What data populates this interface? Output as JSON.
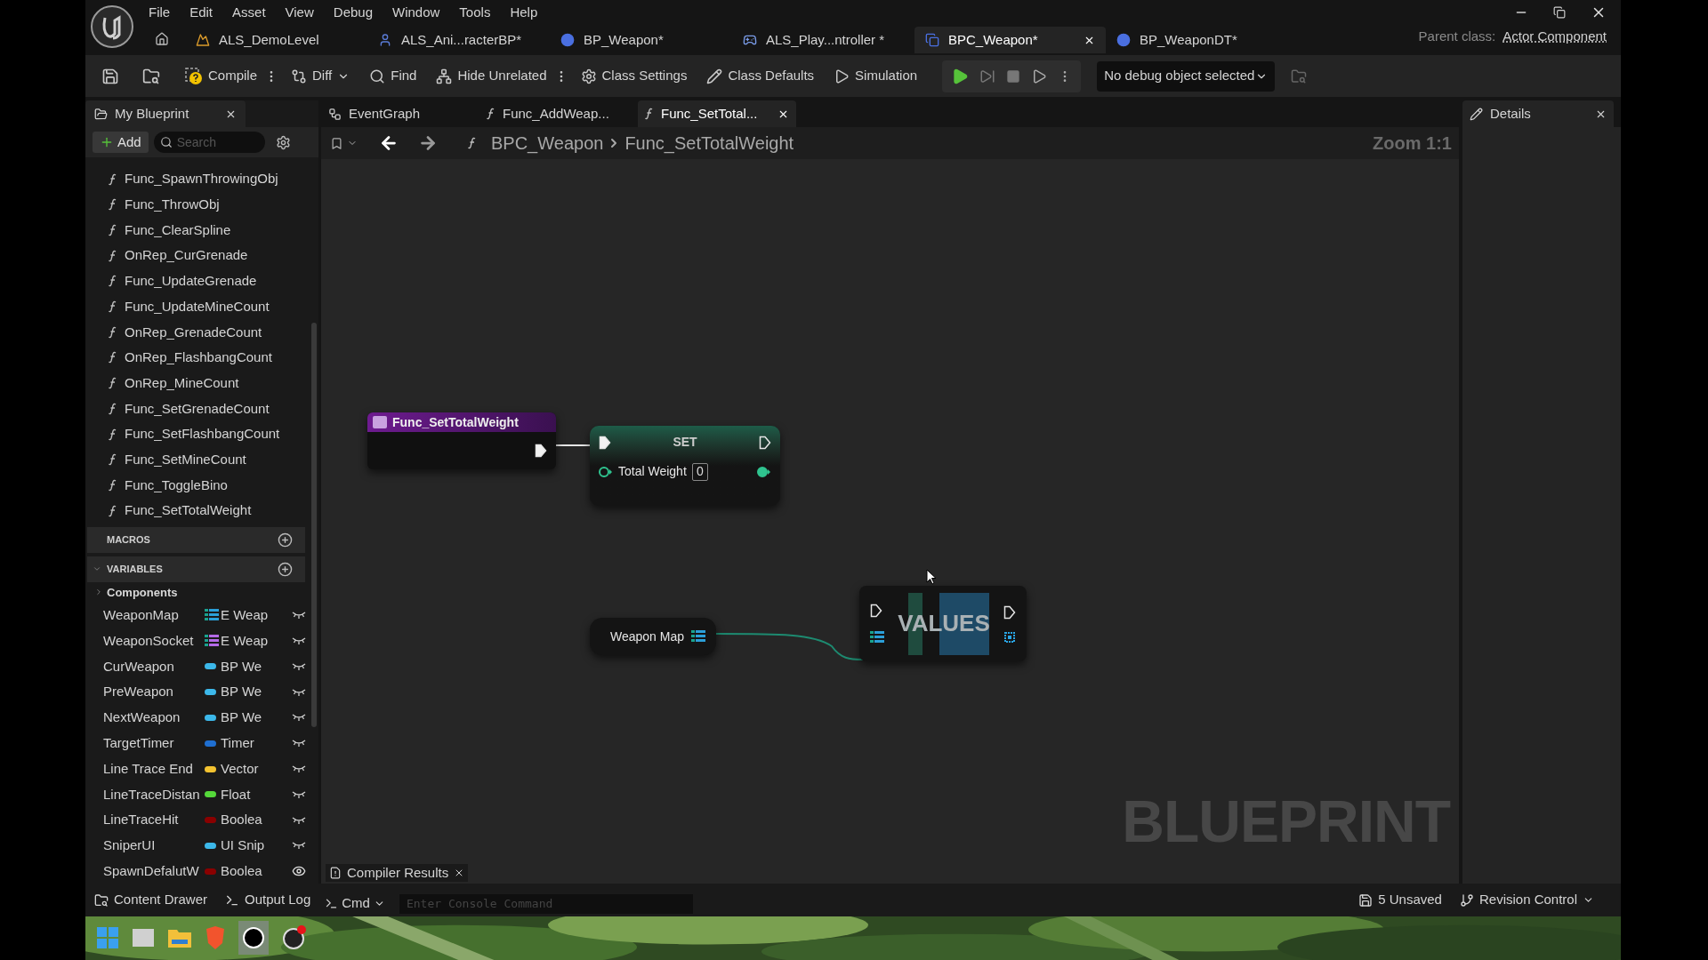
{
  "menu": [
    "File",
    "Edit",
    "Asset",
    "View",
    "Debug",
    "Window",
    "Tools",
    "Help"
  ],
  "document_tabs": [
    {
      "label": "ALS_DemoLevel",
      "kind": "level",
      "selected": false,
      "closable": false
    },
    {
      "label": "ALS_Ani...racterBP*",
      "kind": "character",
      "selected": false,
      "closable": false
    },
    {
      "label": "BP_Weapon*",
      "kind": "actor",
      "selected": false,
      "closable": false
    },
    {
      "label": "ALS_Play...ntroller *",
      "kind": "controller",
      "selected": false,
      "closable": false
    },
    {
      "label": "BPC_Weapon*",
      "kind": "component",
      "selected": true,
      "closable": true
    },
    {
      "label": "BP_WeaponDT*",
      "kind": "actor",
      "selected": false,
      "closable": false
    }
  ],
  "parent_class": {
    "label": "Parent class:",
    "value": "Actor Component"
  },
  "toolbar": [
    {
      "label": "Compile",
      "kind": "compile",
      "more": true
    },
    {
      "label": "Diff",
      "kind": "diff",
      "more": false
    },
    {
      "label": "Find",
      "kind": "find",
      "more": false
    },
    {
      "label": "Hide Unrelated",
      "kind": "hide",
      "more": true
    },
    {
      "label": "Class Settings",
      "kind": "settings",
      "more": false
    },
    {
      "label": "Class Defaults",
      "kind": "defaults",
      "more": false
    },
    {
      "label": "Simulation",
      "kind": "simulation",
      "more": false
    }
  ],
  "debug_dropdown": "No debug object selected",
  "my_blueprint": {
    "title": "My Blueprint",
    "add": "Add",
    "search_placeholder": "Search",
    "functions": [
      "Func_SpawnThrowingObj",
      "Func_ThrowObj",
      "Func_ClearSpline",
      "OnRep_CurGrenade",
      "Func_UpdateGrenade",
      "Func_UpdateMineCount",
      "OnRep_GrenadeCount",
      "OnRep_FlashbangCount",
      "OnRep_MineCount",
      "Func_SetGrenadeCount",
      "Func_SetFlashbangCount",
      "Func_SetMineCount",
      "Func_ToggleBino",
      "Func_SetTotalWeight"
    ],
    "sections": [
      {
        "label": "MACROS"
      },
      {
        "label": "VARIABLES",
        "expanded": true
      }
    ],
    "category": {
      "label": "Components",
      "expanded": false
    },
    "variables": [
      {
        "name": "WeaponMap",
        "type": "E Weap",
        "kind": "map",
        "color": "#2b9fd8",
        "visible": false
      },
      {
        "name": "WeaponSocket",
        "type": "E Weap",
        "kind": "map",
        "color": "#b46ae8",
        "visible": false
      },
      {
        "name": "CurWeapon",
        "type": "BP We",
        "kind": "single",
        "color": "#3cb8ea",
        "visible": false
      },
      {
        "name": "PreWeapon",
        "type": "BP We",
        "kind": "single",
        "color": "#3cb8ea",
        "visible": false
      },
      {
        "name": "NextWeapon",
        "type": "BP We",
        "kind": "single",
        "color": "#3cb8ea",
        "visible": false
      },
      {
        "name": "TargetTimer",
        "type": "Timer",
        "kind": "single",
        "color": "#1f6fd1",
        "visible": false
      },
      {
        "name": "Line Trace End",
        "type": "Vector",
        "kind": "single",
        "color": "#f2c230",
        "visible": false
      },
      {
        "name": "LineTraceDistan",
        "type": "Float",
        "kind": "single",
        "color": "#55d83a",
        "visible": false
      },
      {
        "name": "LineTraceHit",
        "type": "Boolea",
        "kind": "single",
        "color": "#8a0000",
        "visible": false
      },
      {
        "name": "SniperUI",
        "type": "UI Snip",
        "kind": "single",
        "color": "#3cb8ea",
        "visible": false
      },
      {
        "name": "SpawnDefalutW",
        "type": "Boolea",
        "kind": "single",
        "color": "#8a0000",
        "visible": true
      }
    ]
  },
  "graph_tabs": [
    {
      "label": "EventGraph",
      "kind": "graph",
      "selected": false,
      "closable": false
    },
    {
      "label": "Func_AddWeap...",
      "kind": "function",
      "selected": false,
      "closable": false
    },
    {
      "label": "Func_SetTotal...",
      "kind": "function",
      "selected": true,
      "closable": true
    }
  ],
  "breadcrumb": [
    "BPC_Weapon",
    "Func_SetTotalWeight"
  ],
  "zoom": "Zoom 1:1",
  "nodes": {
    "entry": "Func_SetTotalWeight",
    "set": {
      "title": "SET",
      "pin": "Total Weight",
      "value": "0"
    },
    "getter": "Weapon Map",
    "values": "VALUES"
  },
  "watermark": "BLUEPRINT",
  "details": {
    "title": "Details"
  },
  "bottom_bar": {
    "content_drawer": "Content Drawer",
    "output_log": "Output Log",
    "cmd": "Cmd",
    "console_placeholder": "Enter Console Command",
    "compiler_results": "Compiler Results",
    "unsaved": "5 Unsaved",
    "revision": "Revision Control"
  }
}
